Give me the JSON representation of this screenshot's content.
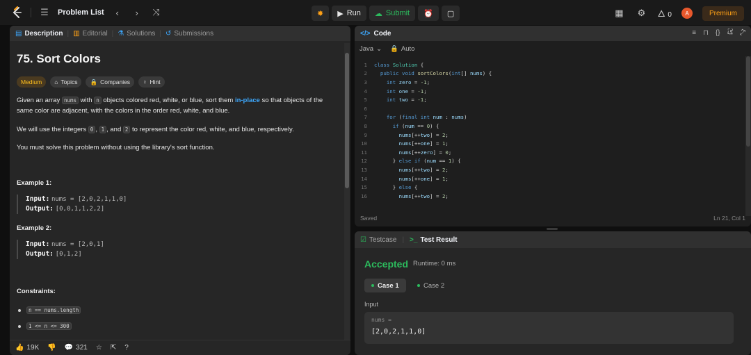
{
  "navbar": {
    "logo_icon": "leetcode-logo-icon",
    "problem_list": "Problem List",
    "run_label": "Run",
    "submit_label": "Submit",
    "streak_count": "0",
    "avatar_initial": "A",
    "premium_label": "Premium",
    "accent_color": "#ffa116",
    "submit_color": "#2cbb5d"
  },
  "left_tabs": [
    {
      "label": "Description",
      "icon": "description-icon"
    },
    {
      "label": "Editorial",
      "icon": "book-icon"
    },
    {
      "label": "Solutions",
      "icon": "flask-icon"
    },
    {
      "label": "Submissions",
      "icon": "history-icon"
    }
  ],
  "problem": {
    "title": "75. Sort Colors",
    "difficulty": "Medium",
    "tags": [
      "Topics",
      "Companies",
      "Hint"
    ],
    "para1_a": "Given an array ",
    "para1_code": "nums",
    "para1_b": " with ",
    "para1_code2": "n",
    "para1_c": " objects colored red, white, or blue, sort them ",
    "para1_link": "in-place",
    "para1_d": " so that objects of the",
    "para1_line2": "same color are adjacent, with the colors in the order red, white, and blue.",
    "para2_a": "We will use the integers ",
    "para2_c0": "0",
    "para2_b": ", ",
    "para2_c1": "1",
    "para2_c": ", and ",
    "para2_c2": "2",
    "para2_d": " to represent the color red, white, and blue, respectively.",
    "para3": "You must solve this problem without using the library's sort function.",
    "example1_title": "Example 1:",
    "example1_input_label": "Input:",
    "example1_input_value": "nums = [2,0,2,1,1,0]",
    "example1_output_label": "Output:",
    "example1_output_value": "[0,0,1,1,2,2]",
    "example2_title": "Example 2:",
    "example2_input_label": "Input:",
    "example2_input_value": "nums = [2,0,1]",
    "example2_output_label": "Output:",
    "example2_output_value": "[0,1,2]",
    "constraints_title": "Constraints:",
    "constraints": [
      "n == nums.length",
      "1 <= n <= 300"
    ]
  },
  "footer": {
    "likes": "19K",
    "comments": "321"
  },
  "code_panel": {
    "title": "Code",
    "language": "Java",
    "mode": "Auto",
    "status_left": "Saved",
    "status_right": "Ln 21, Col 1"
  },
  "code_lines": [
    {
      "n": "1",
      "html": "<span class=\"kw\">class</span> <span class=\"ty\">Solution</span> {"
    },
    {
      "n": "2",
      "html": "  <span class=\"kw\">public void</span> <span class=\"fn\">sortColors</span>(<span class=\"kw\">int</span>[] <span class=\"vr\">nums</span>) {"
    },
    {
      "n": "3",
      "html": "    <span class=\"kw\">int</span> <span class=\"vr\">zero</span> = <span class=\"nm\">-1</span>;"
    },
    {
      "n": "4",
      "html": "    <span class=\"kw\">int</span> <span class=\"vr\">one</span> = <span class=\"nm\">-1</span>;"
    },
    {
      "n": "5",
      "html": "    <span class=\"kw\">int</span> <span class=\"vr\">two</span> = <span class=\"nm\">-1</span>;"
    },
    {
      "n": "6",
      "html": ""
    },
    {
      "n": "7",
      "html": "    <span class=\"kw\">for</span> (<span class=\"kw\">final int</span> <span class=\"vr\">num</span> : <span class=\"vr\">nums</span>)"
    },
    {
      "n": "8",
      "html": "      <span class=\"kw\">if</span> (<span class=\"vr\">num</span> == <span class=\"nm\">0</span>) {"
    },
    {
      "n": "9",
      "html": "        <span class=\"vr\">nums</span>[++<span class=\"vr\">two</span>] = <span class=\"nm\">2</span>;"
    },
    {
      "n": "10",
      "html": "        <span class=\"vr\">nums</span>[++<span class=\"vr\">one</span>] = <span class=\"nm\">1</span>;"
    },
    {
      "n": "11",
      "html": "        <span class=\"vr\">nums</span>[++<span class=\"vr\">zero</span>] = <span class=\"nm\">0</span>;"
    },
    {
      "n": "12",
      "html": "      } <span class=\"kw\">else if</span> (<span class=\"vr\">num</span> == <span class=\"nm\">1</span>) {"
    },
    {
      "n": "13",
      "html": "        <span class=\"vr\">nums</span>[++<span class=\"vr\">two</span>] = <span class=\"nm\">2</span>;"
    },
    {
      "n": "14",
      "html": "        <span class=\"vr\">nums</span>[++<span class=\"vr\">one</span>] = <span class=\"nm\">1</span>;"
    },
    {
      "n": "15",
      "html": "      } <span class=\"kw\">else</span> {"
    },
    {
      "n": "16",
      "html": "        <span class=\"vr\">nums</span>[++<span class=\"vr\">two</span>] = <span class=\"nm\">2</span>;"
    }
  ],
  "test_panel": {
    "tab_testcase": "Testcase",
    "tab_result": "Test Result",
    "verdict": "Accepted",
    "runtime": "Runtime: 0 ms",
    "case1": "Case 1",
    "case2": "Case 2",
    "input_label": "Input",
    "input_key": "nums =",
    "input_value": "[2,0,2,1,1,0]"
  }
}
